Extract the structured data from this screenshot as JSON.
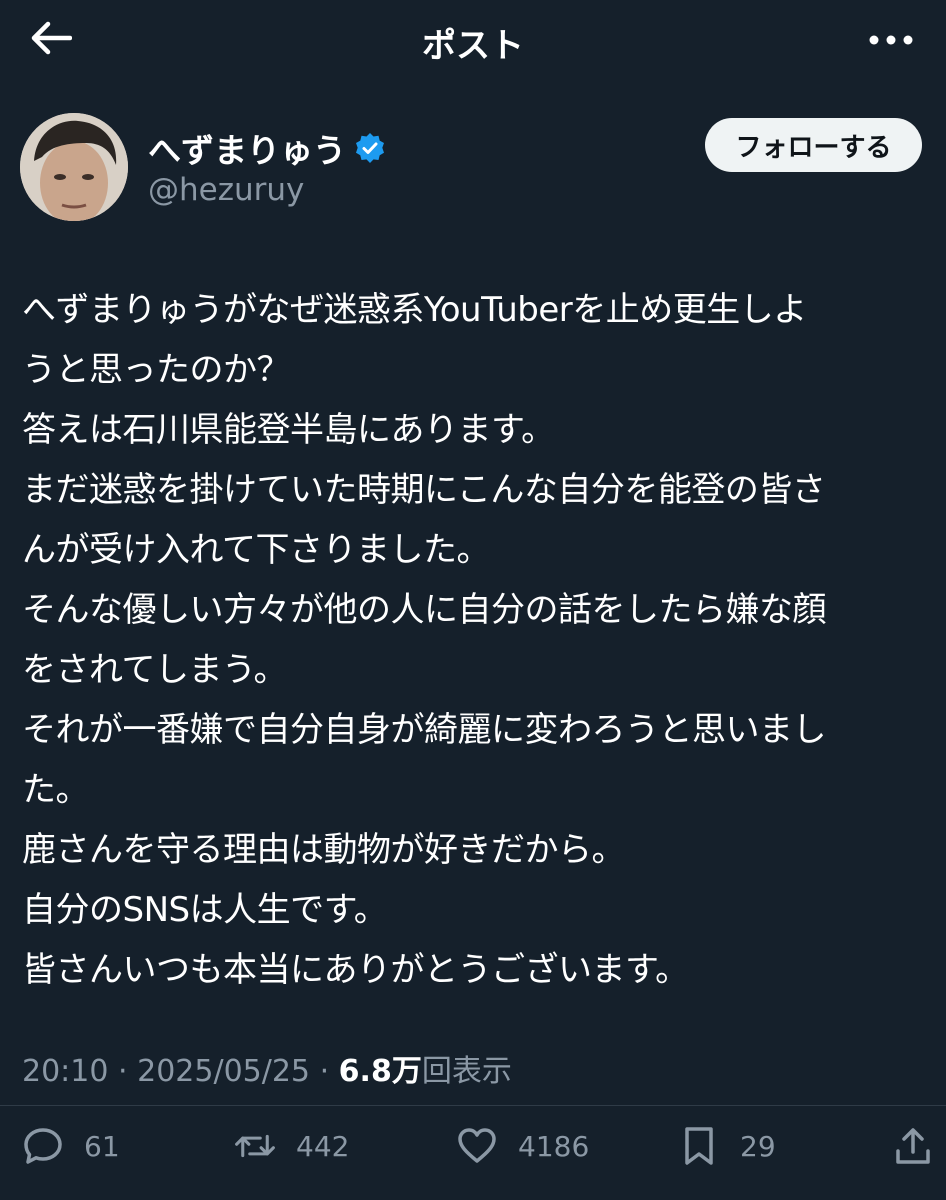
{
  "header": {
    "title": "ポスト",
    "back_icon": "arrow-left-icon",
    "more_icon": "more-horizontal-icon"
  },
  "author": {
    "name": "へずまりゅう",
    "handle": "@hezuruy",
    "verified": true,
    "verified_color": "#1d9bf0",
    "follow_label": "フォローする"
  },
  "post": {
    "lines": [
      "へずまりゅうがなぜ迷惑系YouTuberを止め更生しよ",
      "うと思ったのか？",
      "答えは石川県能登半島にあります。",
      "まだ迷惑を掛けていた時期にこんな自分を能登の皆さ",
      "んが受け入れて下さりました。",
      "そんな優しい方々が他の人に自分の話をしたら嫌な顔",
      "をされてしまう。",
      "それが一番嫌で自分自身が綺麗に変わろうと思いまし",
      "た。",
      "鹿さんを守る理由は動物が好きだから。",
      "自分のSNSは人生です。",
      "皆さんいつも本当にありがとうございます。"
    ]
  },
  "meta": {
    "time": "20:10",
    "separator": "·",
    "date": "2025/05/25",
    "views_count": "6.8万",
    "views_label": "回表示"
  },
  "actions": {
    "reply_count": "61",
    "repost_count": "442",
    "like_count": "4186",
    "bookmark_count": "29"
  },
  "colors": {
    "background": "#15202b",
    "text": "#ffffff",
    "muted": "#8b98a5",
    "follow_bg": "#eff3f4"
  }
}
